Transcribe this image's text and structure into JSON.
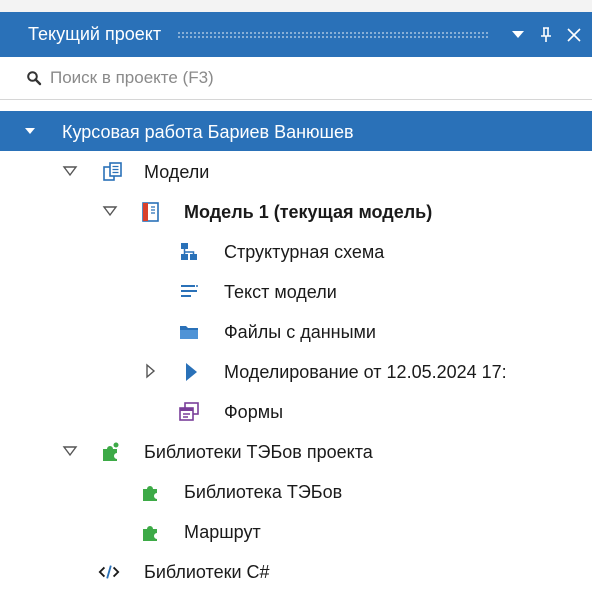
{
  "panel": {
    "title": "Текущий проект",
    "dropdown_icon": "triangle-down-icon",
    "pin_icon": "pin-icon",
    "close_icon": "close-icon"
  },
  "search": {
    "placeholder": "Поиск в проекте (F3)",
    "value": ""
  },
  "tree": {
    "project": {
      "label": "Курсовая работа Бариев Ванюшев",
      "expanded": true,
      "selected": true
    },
    "models": {
      "label": "Модели",
      "expanded": true,
      "icon": "models-icon"
    },
    "model1": {
      "label": "Модель 1 (текущая модель)",
      "expanded": true,
      "icon": "model-book-icon",
      "current": true
    },
    "structure": {
      "label": "Структурная схема",
      "icon": "structure-scheme-icon"
    },
    "model_text": {
      "label": "Текст модели",
      "icon": "text-lines-icon"
    },
    "data_files": {
      "label": "Файлы с данными",
      "icon": "folder-icon"
    },
    "simulation": {
      "label": "Моделирование от 12.05.2024 17:",
      "expanded": false,
      "icon": "play-icon"
    },
    "forms": {
      "label": "Формы",
      "icon": "forms-icon"
    },
    "teb_libs": {
      "label": "Библиотеки ТЭБов проекта",
      "expanded": true,
      "icon": "puzzle-icon"
    },
    "teb_lib": {
      "label": "Библиотека ТЭБов",
      "icon": "puzzle-icon"
    },
    "route": {
      "label": "Маршрут",
      "icon": "puzzle-icon"
    },
    "csharp_libs": {
      "label": "Библиотеки C#",
      "icon": "code-icon"
    }
  },
  "colors": {
    "accent": "#2a71b8",
    "icon_blue": "#2a71b8",
    "puzzle_green": "#3daa47",
    "forms_purple": "#7a3f9a",
    "book_red": "#d9402b"
  }
}
